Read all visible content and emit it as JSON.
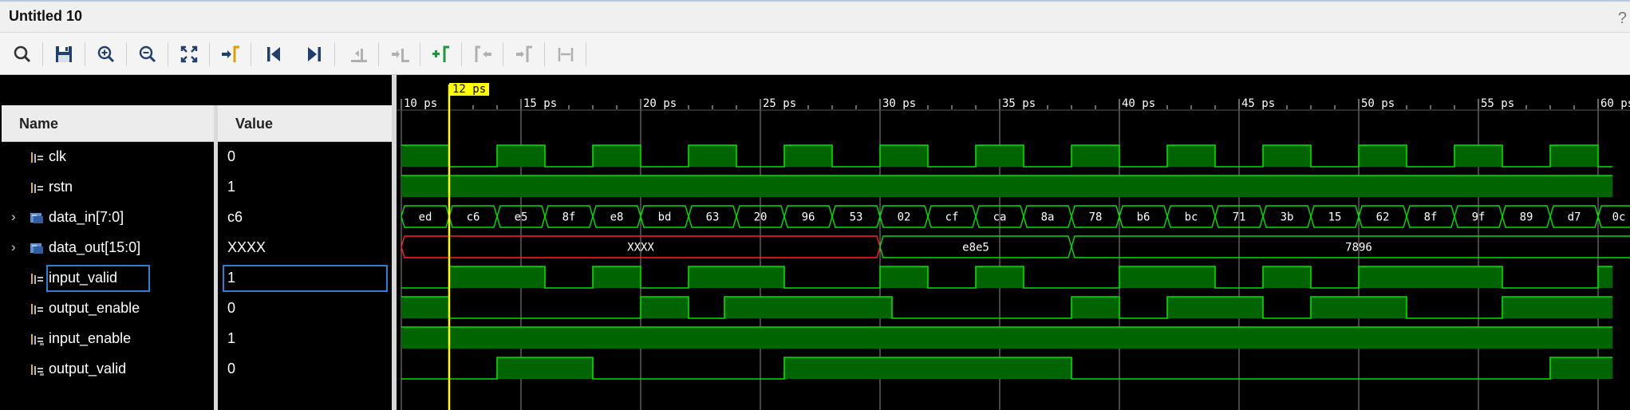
{
  "window": {
    "title": "Untitled 10",
    "help_glyph": "?"
  },
  "toolbar": {
    "buttons": [
      {
        "name": "search-icon",
        "enabled": true
      },
      {
        "name": "save-icon",
        "enabled": true
      },
      {
        "name": "zoom-in-icon",
        "enabled": true
      },
      {
        "name": "zoom-out-icon",
        "enabled": true
      },
      {
        "name": "zoom-fit-icon",
        "enabled": true
      },
      {
        "name": "go-to-cursor-icon",
        "enabled": true
      },
      {
        "name": "go-to-start-icon",
        "enabled": true
      },
      {
        "name": "go-to-end-icon",
        "enabled": true
      },
      {
        "name": "previous-transition-icon",
        "enabled": false
      },
      {
        "name": "next-transition-icon",
        "enabled": false
      },
      {
        "name": "add-marker-icon",
        "enabled": true
      },
      {
        "name": "previous-marker-icon",
        "enabled": false
      },
      {
        "name": "next-marker-icon",
        "enabled": false
      },
      {
        "name": "swap-cursors-icon",
        "enabled": false
      }
    ]
  },
  "columns": {
    "name": "Name",
    "value": "Value"
  },
  "cursor": {
    "time": 12,
    "label": "12 ps",
    "color": "#ffff00"
  },
  "timeline": {
    "unit": "ps",
    "start": 10,
    "end": 60.6,
    "ticks": [
      "10 ps",
      "15 ps",
      "20 ps",
      "25 ps",
      "30 ps",
      "35 ps",
      "40 ps",
      "45 ps",
      "50 ps",
      "55 ps",
      "60 ps"
    ]
  },
  "colors": {
    "wave": "#00e000",
    "wave_fill": "#006400",
    "undefined": "#ff2020",
    "grid": "#d0d0d0",
    "text": "#ffffff",
    "selection": "#2f7fd0"
  },
  "signals": [
    {
      "name": "clk",
      "value": "0",
      "icon": "logic-signal-icon",
      "expandable": false,
      "selected": false,
      "type": "bit",
      "initial": 1,
      "transitions": [
        12,
        14,
        16,
        18,
        20,
        22,
        24,
        26,
        28,
        30,
        32,
        34,
        36,
        38,
        40,
        42,
        44,
        46,
        48,
        50,
        52,
        54,
        56,
        58,
        60
      ]
    },
    {
      "name": "rstn",
      "value": "1",
      "icon": "logic-signal-icon",
      "expandable": false,
      "selected": false,
      "type": "bit",
      "initial": 1,
      "transitions": []
    },
    {
      "name": "data_in[7:0]",
      "value": "c6",
      "icon": "bus-signal-icon",
      "expandable": true,
      "selected": false,
      "type": "bus",
      "segments": [
        {
          "from": 10,
          "to": 12,
          "label": "ed"
        },
        {
          "from": 12,
          "to": 14,
          "label": "c6"
        },
        {
          "from": 14,
          "to": 16,
          "label": "e5"
        },
        {
          "from": 16,
          "to": 18,
          "label": "8f"
        },
        {
          "from": 18,
          "to": 20,
          "label": "e8"
        },
        {
          "from": 20,
          "to": 22,
          "label": "bd"
        },
        {
          "from": 22,
          "to": 24,
          "label": "63"
        },
        {
          "from": 24,
          "to": 26,
          "label": "20"
        },
        {
          "from": 26,
          "to": 28,
          "label": "96"
        },
        {
          "from": 28,
          "to": 30,
          "label": "53"
        },
        {
          "from": 30,
          "to": 32,
          "label": "02"
        },
        {
          "from": 32,
          "to": 34,
          "label": "cf"
        },
        {
          "from": 34,
          "to": 36,
          "label": "ca"
        },
        {
          "from": 36,
          "to": 38,
          "label": "8a"
        },
        {
          "from": 38,
          "to": 40,
          "label": "78"
        },
        {
          "from": 40,
          "to": 42,
          "label": "b6"
        },
        {
          "from": 42,
          "to": 44,
          "label": "bc"
        },
        {
          "from": 44,
          "to": 46,
          "label": "71"
        },
        {
          "from": 46,
          "to": 48,
          "label": "3b"
        },
        {
          "from": 48,
          "to": 50,
          "label": "15"
        },
        {
          "from": 50,
          "to": 52,
          "label": "62"
        },
        {
          "from": 52,
          "to": 54,
          "label": "8f"
        },
        {
          "from": 54,
          "to": 56,
          "label": "9f"
        },
        {
          "from": 56,
          "to": 58,
          "label": "89"
        },
        {
          "from": 58,
          "to": 60,
          "label": "d7"
        },
        {
          "from": 60,
          "to": 62,
          "label": "0c"
        }
      ]
    },
    {
      "name": "data_out[15:0]",
      "value": "XXXX",
      "icon": "bus-signal-icon",
      "expandable": true,
      "selected": false,
      "type": "bus",
      "segments": [
        {
          "from": 10,
          "to": 30,
          "label": "XXXX",
          "undefined": true
        },
        {
          "from": 30,
          "to": 38,
          "label": "e8e5"
        },
        {
          "from": 38,
          "to": 62,
          "label": "7896"
        }
      ]
    },
    {
      "name": "input_valid",
      "value": "1",
      "icon": "logic-signal-icon",
      "expandable": false,
      "selected": true,
      "type": "bit",
      "initial": 0,
      "transitions": [
        12,
        16,
        18,
        20,
        22,
        26,
        30,
        32,
        34,
        36,
        40,
        44,
        46,
        48,
        50,
        56,
        60
      ]
    },
    {
      "name": "output_enable",
      "value": "0",
      "icon": "logic-signal-icon",
      "expandable": false,
      "selected": false,
      "type": "bit",
      "initial": 1,
      "transitions": [
        12,
        20,
        22,
        23.5,
        30.5,
        38,
        40,
        42,
        46,
        48,
        52,
        56
      ]
    },
    {
      "name": "input_enable",
      "value": "1",
      "icon": "logic-input-icon",
      "expandable": false,
      "selected": false,
      "type": "bit",
      "initial": 1,
      "transitions": []
    },
    {
      "name": "output_valid",
      "value": "0",
      "icon": "logic-input-icon",
      "expandable": false,
      "selected": false,
      "type": "bit",
      "initial": 0,
      "transitions": [
        14,
        18,
        26,
        38,
        58
      ]
    }
  ]
}
